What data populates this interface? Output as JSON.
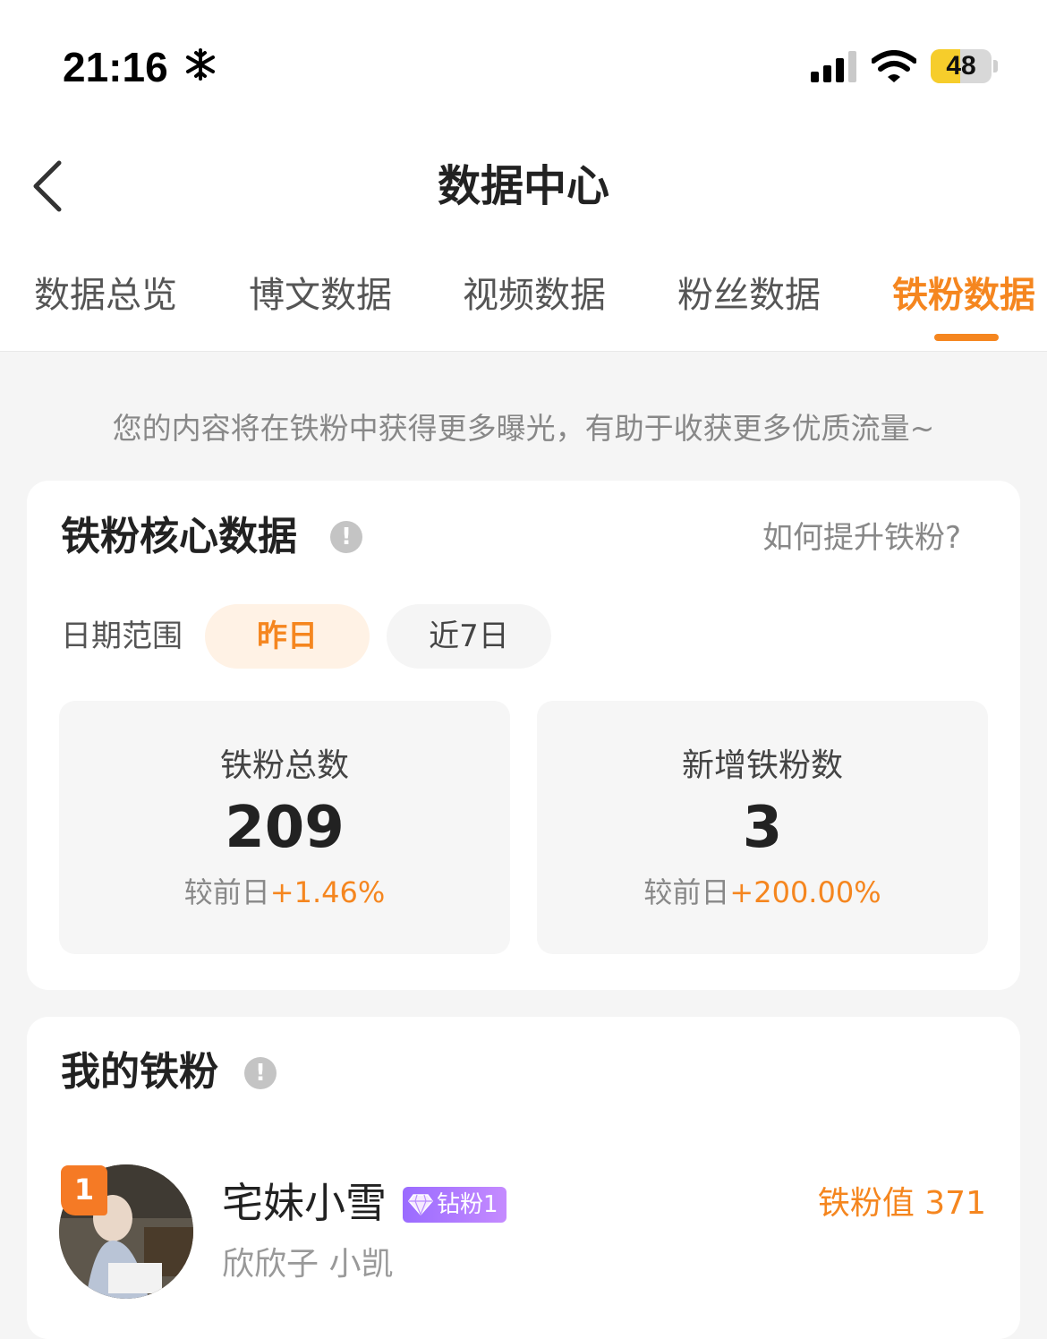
{
  "status_bar": {
    "time": "21:16",
    "battery": "48",
    "battery_level": 0.48
  },
  "nav": {
    "title": "数据中心"
  },
  "tabs": [
    {
      "label": "数据总览",
      "active": false
    },
    {
      "label": "博文数据",
      "active": false
    },
    {
      "label": "视频数据",
      "active": false
    },
    {
      "label": "粉丝数据",
      "active": false
    },
    {
      "label": "铁粉数据",
      "active": true
    }
  ],
  "tip": "您的内容将在铁粉中获得更多曝光，有助于收获更多优质流量~",
  "core": {
    "title": "铁粉核心数据",
    "help_link": "如何提升铁粉?",
    "range_label": "日期范围",
    "ranges": [
      "昨日",
      "近7日"
    ],
    "stats": [
      {
        "label": "铁粉总数",
        "value": "209",
        "change_prefix": "较前日",
        "change": "+1.46%"
      },
      {
        "label": "新增铁粉数",
        "value": "3",
        "change_prefix": "较前日",
        "change": "+200.00%"
      }
    ]
  },
  "my_fans": {
    "title": "我的铁粉",
    "items": [
      {
        "rank": "1",
        "name": "宅妹小雪",
        "badge": "钻粉1",
        "subtitle": "欣欣子 小凯",
        "value": "铁粉值 371"
      }
    ]
  },
  "colors": {
    "accent": "#f5861f",
    "background": "#f5f5f5"
  }
}
